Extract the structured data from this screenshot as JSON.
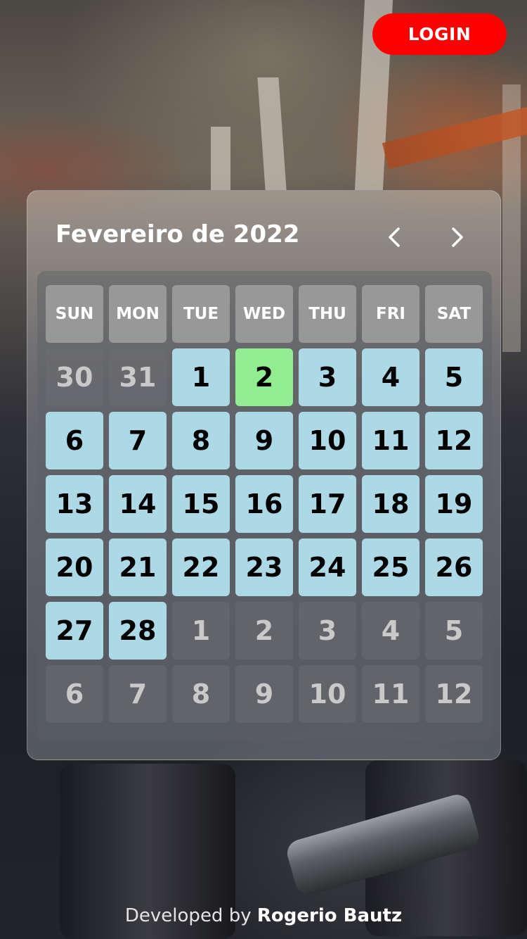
{
  "header": {
    "login_label": "LOGIN"
  },
  "calendar": {
    "month_title": "Fevereiro de 2022",
    "weekdays": [
      "SUN",
      "MON",
      "TUE",
      "WED",
      "THU",
      "FRI",
      "SAT"
    ],
    "days": [
      {
        "label": "30",
        "state": "other"
      },
      {
        "label": "31",
        "state": "other"
      },
      {
        "label": "1",
        "state": "cur"
      },
      {
        "label": "2",
        "state": "today"
      },
      {
        "label": "3",
        "state": "cur"
      },
      {
        "label": "4",
        "state": "cur"
      },
      {
        "label": "5",
        "state": "cur"
      },
      {
        "label": "6",
        "state": "cur"
      },
      {
        "label": "7",
        "state": "cur"
      },
      {
        "label": "8",
        "state": "cur"
      },
      {
        "label": "9",
        "state": "cur"
      },
      {
        "label": "10",
        "state": "cur"
      },
      {
        "label": "11",
        "state": "cur"
      },
      {
        "label": "12",
        "state": "cur"
      },
      {
        "label": "13",
        "state": "cur"
      },
      {
        "label": "14",
        "state": "cur"
      },
      {
        "label": "15",
        "state": "cur"
      },
      {
        "label": "16",
        "state": "cur"
      },
      {
        "label": "17",
        "state": "cur"
      },
      {
        "label": "18",
        "state": "cur"
      },
      {
        "label": "19",
        "state": "cur"
      },
      {
        "label": "20",
        "state": "cur"
      },
      {
        "label": "21",
        "state": "cur"
      },
      {
        "label": "22",
        "state": "cur"
      },
      {
        "label": "23",
        "state": "cur"
      },
      {
        "label": "24",
        "state": "cur"
      },
      {
        "label": "25",
        "state": "cur"
      },
      {
        "label": "26",
        "state": "cur"
      },
      {
        "label": "27",
        "state": "cur"
      },
      {
        "label": "28",
        "state": "cur"
      },
      {
        "label": "1",
        "state": "other"
      },
      {
        "label": "2",
        "state": "other"
      },
      {
        "label": "3",
        "state": "other"
      },
      {
        "label": "4",
        "state": "other"
      },
      {
        "label": "5",
        "state": "other"
      },
      {
        "label": "6",
        "state": "other"
      },
      {
        "label": "7",
        "state": "other"
      },
      {
        "label": "8",
        "state": "other"
      },
      {
        "label": "9",
        "state": "other"
      },
      {
        "label": "10",
        "state": "other"
      },
      {
        "label": "11",
        "state": "other"
      },
      {
        "label": "12",
        "state": "other"
      }
    ],
    "colors": {
      "current_month_day": "#add8e6",
      "today": "#90ee90",
      "login_button": "#ff0000"
    },
    "icons": {
      "prev": "chevron-left-icon",
      "next": "chevron-right-icon"
    }
  },
  "footer": {
    "prefix": "Developed by",
    "author": "Rogerio Bautz"
  }
}
